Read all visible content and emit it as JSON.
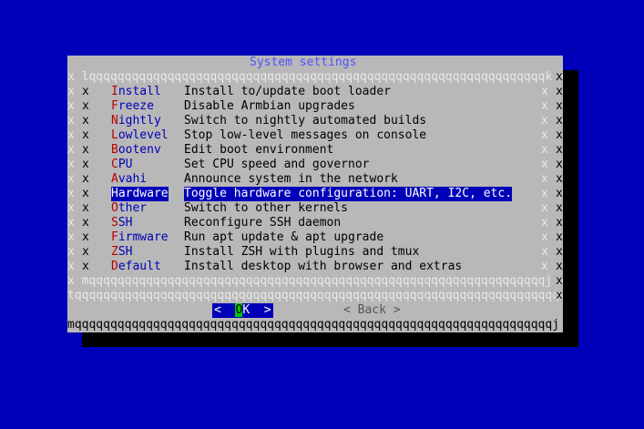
{
  "dialog": {
    "title": "System settings",
    "top_border_left": "lqqqqqqqqqqqqqqqqqqqqqqq",
    "top_border_right": "qqqqqqqqqqqqqqqqqqqqqqqqqqk",
    "inner_top": "x lqqqqqqqqqqqqqqqqqqqqqqqqqqqqqqqqqqqqqqqqqqqqqqqqqqqqqqqqqqqqqqqqk x",
    "inner_bottom": "x mqqqqqqqqqqqqqqqqqqqqqqqqqqqqqqqqqqqqqqqqqqqqqqqqqqqqqqqqqqqqqqqqj x",
    "separator": "tqqqqqqqqqqqqqqqqqqqqqqqqqqqqqqqqqqqqqqqqqqqqqqqqqqqqqqqqqqqqqqqqqqqqu",
    "bottom_border": "mqqqqqqqqqqqqqqqqqqqqqqqqqqqqqqqqqqqqqqqqqqqqqqqqqqqqqqqqqqqqqqqqqqqj",
    "side": "x"
  },
  "menu": [
    {
      "hot": "I",
      "rest": "nstall",
      "desc": "Install to/update boot loader"
    },
    {
      "hot": "F",
      "rest": "reeze",
      "desc": "Disable Armbian upgrades"
    },
    {
      "hot": "N",
      "rest": "ightly",
      "desc": "Switch to nightly automated builds"
    },
    {
      "hot": "L",
      "rest": "owlevel",
      "desc": "Stop low-level messages on console"
    },
    {
      "hot": "B",
      "rest": "ootenv",
      "desc": "Edit boot environment"
    },
    {
      "hot": "C",
      "rest": "PU",
      "desc": "Set CPU speed and governor"
    },
    {
      "hot": "A",
      "rest": "vahi",
      "desc": "Announce system in the network"
    },
    {
      "hot": "H",
      "rest": "ardware",
      "desc": "Toggle hardware configuration: UART, I2C, etc.",
      "selected": true
    },
    {
      "hot": "O",
      "rest": "ther",
      "desc": "Switch to other kernels"
    },
    {
      "hot": "S",
      "rest": "SH",
      "desc": "Reconfigure SSH daemon"
    },
    {
      "hot": "F",
      "rest": "irmware",
      "desc": "Run apt update & apt upgrade"
    },
    {
      "hot": "Z",
      "rest": "SH",
      "desc": "Install ZSH with plugins and tmux"
    },
    {
      "hot": "D",
      "rest": "efault",
      "desc": "Install desktop with browser and extras"
    }
  ],
  "buttons": {
    "ok_left": "<  ",
    "ok_hot": "O",
    "ok_rest": "K  >",
    "back": "< Back >"
  }
}
